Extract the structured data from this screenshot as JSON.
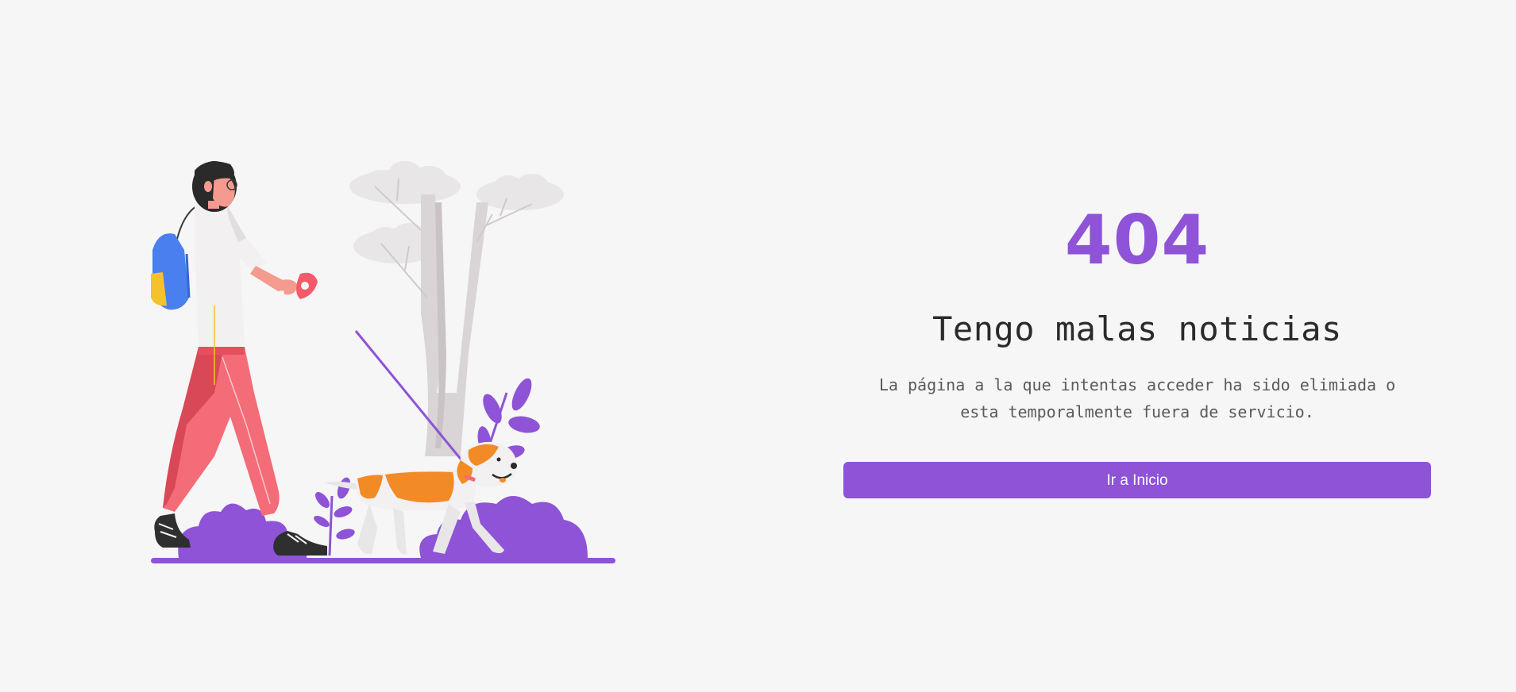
{
  "error": {
    "code": "404",
    "heading": "Tengo malas noticias",
    "message": "La página a la que intentas acceder ha sido elimiada o esta temporalmente fuera de servicio.",
    "button_label": "Ir a Inicio"
  },
  "colors": {
    "accent": "#8e53d6",
    "background": "#f6f6f6",
    "heading_text": "#2a2a2a",
    "body_text": "#5a5a5a"
  },
  "illustration": {
    "icon": "woman-walking-dog-illustration"
  }
}
